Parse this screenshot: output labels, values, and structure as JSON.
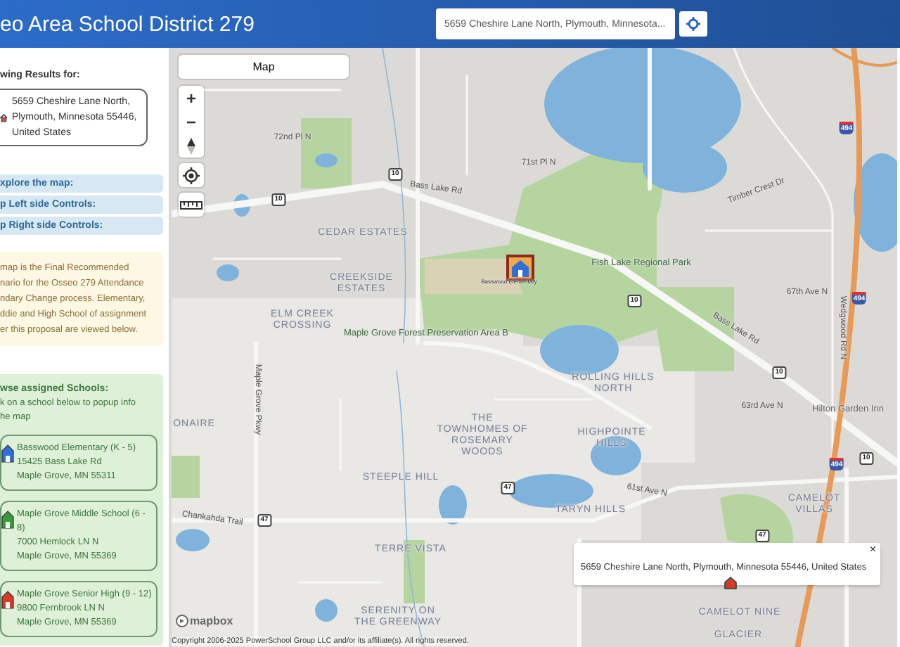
{
  "header": {
    "title": "eo Area School District 279",
    "search": {
      "value": "5659 Cheshire Lane North, Plymouth, Minnesota..."
    }
  },
  "sidebar": {
    "results_heading": "wing Results for:",
    "address": "5659 Cheshire Lane North, Plymouth, Minnesota 55446, United States",
    "sections": [
      "xplore the map:",
      "p Left side Controls:",
      "p Right side Controls:"
    ],
    "notice": "map is the Final Recommended\nnario for the Osseo 279 Attendance\nndary Change process. Elementary,\nddie and High School of assignment\ner this proposal are viewed below.",
    "schools_panel": {
      "heading": "wse assigned Schools:",
      "hint": "k on a school below to popup info\nhe map",
      "schools": [
        {
          "name": "Basswood Elementary (K - 5)",
          "address_line_1": "15425 Bass Lake Rd",
          "address_line_2": "Maple Grove, MN 55311",
          "color": "#2f6fd6"
        },
        {
          "name": "Maple Grove Middle School (6 - 8)",
          "address_line_1": "7000 Hemlock LN N",
          "address_line_2": "Maple Grove, MN 55369",
          "color": "#3a9a3a"
        },
        {
          "name": "Maple Grove Senior High (9 - 12)",
          "address_line_1": "9800 Fernbrook LN N",
          "address_line_2": "Maple Grove, MN 55369",
          "color": "#d83a2a"
        }
      ]
    }
  },
  "map": {
    "style_button": "Map",
    "controls": [
      {
        "kind": "zoom_in",
        "label": "+"
      },
      {
        "kind": "zoom_out",
        "label": "−"
      },
      {
        "kind": "compass"
      },
      {
        "kind": "locate"
      },
      {
        "kind": "ruler"
      }
    ],
    "labels": [
      {
        "kind": "road",
        "text": "72nd Pl N"
      },
      {
        "kind": "road",
        "text": "71st Pl N"
      },
      {
        "kind": "road",
        "text": "Bass Lake Rd"
      },
      {
        "kind": "road",
        "text": "Timber Crest Dr"
      },
      {
        "kind": "place",
        "text": "CEDAR ESTATES"
      },
      {
        "kind": "place",
        "text": "CREEKSIDE ESTATES"
      },
      {
        "kind": "place",
        "text": "ELM CREEK CROSSING"
      },
      {
        "kind": "park",
        "text": "Maple Grove Forest Preservation Area B"
      },
      {
        "kind": "park",
        "text": "Fish Lake Regional Park"
      },
      {
        "kind": "road",
        "text": "67th Ave N"
      },
      {
        "kind": "road",
        "text": "Wedgwood Rd N"
      },
      {
        "kind": "road",
        "text": "Bass Lake Rd"
      },
      {
        "kind": "road",
        "text": "63rd Ave N"
      },
      {
        "kind": "poi",
        "text": "Hilton Garden Inn"
      },
      {
        "kind": "place",
        "text": "ROLLING HILLS NORTH"
      },
      {
        "kind": "place",
        "text": "HIGHPOINTE HILLS"
      },
      {
        "kind": "place",
        "text": "ONAIRE"
      },
      {
        "kind": "place",
        "text": "THE TOWNHOMES OF ROSEMARY WOODS"
      },
      {
        "kind": "road",
        "text": "Maple Grove Pkwy"
      },
      {
        "kind": "place",
        "text": "STEEPLE HILL"
      },
      {
        "kind": "road",
        "text": "61st Ave N"
      },
      {
        "kind": "place",
        "text": "TARYN HILLS"
      },
      {
        "kind": "place",
        "text": "CAMELOT VILLAS"
      },
      {
        "kind": "road",
        "text": "Chankahda Trail"
      },
      {
        "kind": "place",
        "text": "TERRE VISTA"
      },
      {
        "kind": "place",
        "text": "SERENITY ON THE GREENWAY"
      },
      {
        "kind": "place",
        "text": "CAMELOT NINE"
      },
      {
        "kind": "place",
        "text": "GLACIER"
      },
      {
        "kind": "marker",
        "text": "Basswood Elementary"
      }
    ],
    "shields": [
      {
        "kind": "state",
        "text": "10"
      },
      {
        "kind": "state",
        "text": "10"
      },
      {
        "kind": "state",
        "text": "10"
      },
      {
        "kind": "state",
        "text": "10"
      },
      {
        "kind": "state",
        "text": "10"
      },
      {
        "kind": "state",
        "text": "47"
      },
      {
        "kind": "state",
        "text": "47"
      },
      {
        "kind": "state",
        "text": "47"
      },
      {
        "kind": "interstate",
        "text": "494"
      },
      {
        "kind": "interstate",
        "text": "494"
      },
      {
        "kind": "interstate",
        "text": "494"
      }
    ],
    "popup": {
      "text": "5659 Cheshire Lane North, Plymouth, Minnesota 55446, United States",
      "close": "×"
    },
    "logo": "mapbox",
    "copyright": "Copyright 2006-2025 PowerSchool Group LLC and/or its affiliate(s). All rights reserved."
  }
}
